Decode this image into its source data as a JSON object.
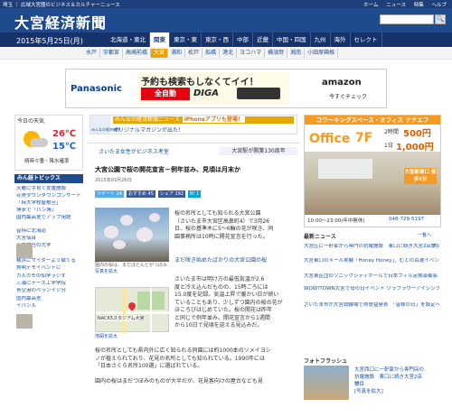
{
  "topbar": {
    "left": "埼玉 ｜ 広域大宮圏のビジネス＆カルチャーニュース",
    "links": [
      "ホーム",
      "ニュース",
      "特集",
      "ヘルプ"
    ]
  },
  "header": {
    "logo": "大宮経済新聞",
    "search_button": "🔍"
  },
  "datebar": {
    "date": "2015年5月25日(月)",
    "regions": [
      "北海道・東北",
      "関東",
      "東京・東",
      "東京・西",
      "中部",
      "近畿",
      "中国・四国",
      "九州",
      "海外",
      "セレクト"
    ],
    "active_region": "関東"
  },
  "cities": {
    "items": [
      "水戸",
      "宇都宮",
      "高崎前橋",
      "大宮",
      "浦和",
      "松戸",
      "船橋",
      "港北",
      "ヨコハマ",
      "横須賀",
      "湘南",
      "小田原箱根"
    ],
    "active": "大宮"
  },
  "banner": {
    "brand": "Panasonic",
    "headline": "予約も検索もしなくてイイ！",
    "tag": "全自動",
    "product": "DIGA",
    "store": "amazon",
    "store_sub": "今すぐチェック"
  },
  "weather": {
    "title": "今日の天気",
    "high": "26℃",
    "low": "15℃",
    "desc": "晴時々曇・降水確率"
  },
  "ranking": {
    "title": "みん経トピックス",
    "items": [
      "天麗に手育て支援施設",
      "花咲ダウンタウンコンサート",
      "「特大学校屋根旦」",
      "博多で「パン博」",
      "国内最高室でアップ用語",
      "昔特に北海道",
      "大宮仙台",
      "小鹿神社の大学",
      "横浜にサイダーよう描てる",
      "秀明デモイベントに",
      "カルカモの仙学ラジオ",
      "三浦にチーズ工学学院",
      "青空港のベランイジ分",
      "国内最高室",
      "イバンル"
    ]
  },
  "newsbar": {
    "app_label": "みんなの経済新聞",
    "line1": "みんなの経済新聞ニュース",
    "line1_tag": "iPhoneアプリも登場！",
    "line2": "オリジナルマガジンが出た！"
  },
  "article": {
    "breadcrumb": "さいたま女性がビジネス考室",
    "side_crumb": "大宮駅が開業130周年",
    "title": "大宮公園で桜の開花宣言－例年並み、見頃は月末か",
    "date": "2015年03月26日",
    "social": [
      "ツイート 14",
      "おすすめ 45",
      "シェア 192",
      "B! 1"
    ],
    "caption": "園内の桜は、まだほとんどがつぼみ",
    "enlarge1": "写真を拡大",
    "enlarge2": "地図を拡大",
    "map_label": "NACK5スタジアム大宮",
    "bigbtn": "まだ咲き始めたばかりの大宮公園の桜",
    "para1": [
      "桜の名所としても知られる大宮公園",
      "（さいたま市大宮区高鼻町4）で3月26",
      "日、桜の基準木に5～6輪の花が咲き、同",
      "園事務所は10時に開花宣言を行った。"
    ],
    "para2": [
      "さいたま市は明け方の最低気温が2.6",
      "度と冷え込んだものの、15時ごろには",
      "15.0度を記録。気温上昇で暖かい日が続い",
      "ていることもあり、少しずつ園内の桜の花が",
      "ほころびはじめていた。桜の開花は昨年",
      "と同じで例年並み。開花宣言から1週間",
      "から10日で見頃を迎える見込みだ。"
    ],
    "para3": [
      "桜の名所としても県内外に広く知られる同園には約1000本のソメイヨシ",
      "ノが植えられており、花見の名所としても知られている。1990年には",
      "「日本さくら名所100選」に選ばれている。",
      "",
      "園内の桜はまだつぼみのものが大半だが、花見客向けの屋台なども見"
    ]
  },
  "cowork": {
    "title": "コワーキングスペース・オフィス ナナエフ",
    "office": "Office",
    "floor": "7F",
    "price2h_label": "2時間",
    "price2h": "500円",
    "price1d_label": "1日",
    "price1d": "1,000円",
    "badge": "大宮駅東口 徒歩1分",
    "hours": "10:00～23:00(年中無休)",
    "tel": "048-729-5197"
  },
  "latest": {
    "title": "最新ニュース",
    "more": "一覧へ",
    "items": [
      "大宮区に一軒家から専門の抗電施設　東口に続き大宮2店舗目",
      "大宮東口のメール実験「Honey Honey」、むとの百選イベント開催",
      "大宮東区団のソニックシティホールで日本フィル定期演奏会",
      "WOW!TOWN大宮で母の日イベント ソラフラワーアイシングクッキーのワークショ…",
      "さいたま市が大宮競輪場で得意益発表　「皆様の日」を設定へ"
    ]
  },
  "photo": {
    "title": "フォトフラッシュ",
    "text": [
      "大宮西口に一軒家から専門店の",
      "抗電施設　東口に続き大宮2店",
      "舗目",
      "[写真を拡大]"
    ]
  }
}
